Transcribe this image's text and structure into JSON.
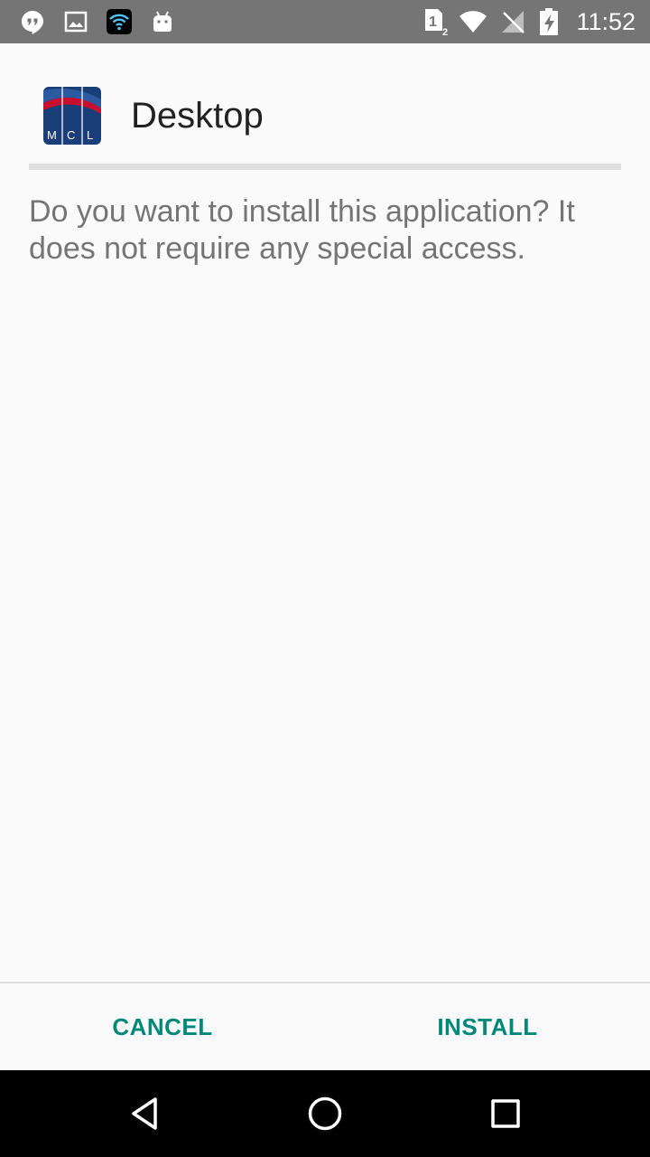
{
  "status_bar": {
    "time": "11:52",
    "sim_label_1": "1",
    "sim_label_2": "2",
    "left_icons": [
      "hangouts-icon",
      "image-icon",
      "wifi-icon",
      "android-icon"
    ],
    "right_icons": [
      "sim-icon",
      "wifi-signal-icon",
      "no-sim-signal-icon",
      "battery-charging-icon"
    ]
  },
  "app": {
    "name": "Desktop",
    "logo_text": "MCL"
  },
  "message": "Do you want to install this application? It does not require any special access.",
  "buttons": {
    "cancel": "CANCEL",
    "install": "INSTALL"
  },
  "nav": {
    "icons": [
      "back-icon",
      "home-icon",
      "recents-icon"
    ]
  },
  "colors": {
    "status_bar": "#757575",
    "background": "#fafafa",
    "accent": "#00897b",
    "message_text": "#757575",
    "title_text": "#212121",
    "logo_blue": "#1a3e78",
    "logo_red": "#c8102e"
  }
}
